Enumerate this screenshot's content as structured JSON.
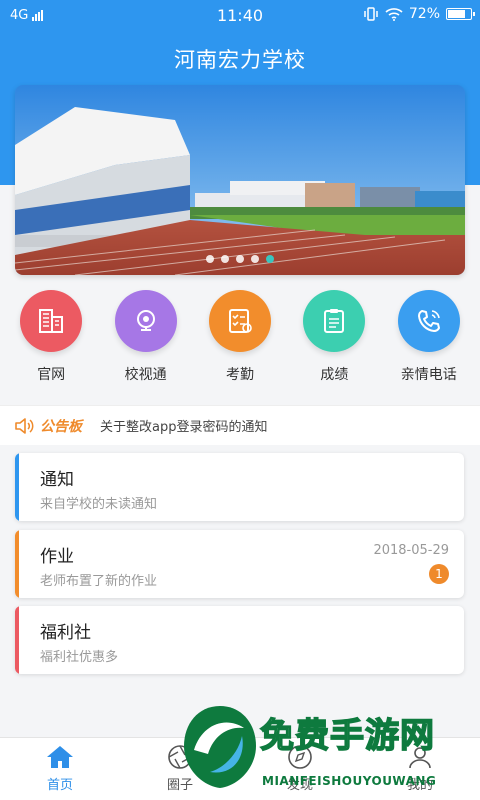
{
  "status_bar": {
    "network": "4G",
    "time": "11:40",
    "battery": "72%",
    "battery_level": 0.72
  },
  "header": {
    "title": "河南宏力学校"
  },
  "banner": {
    "slide_count": 5,
    "active_slide": 5
  },
  "quick_actions": [
    {
      "label": "官网",
      "icon": "building-icon",
      "color": "#ec5a62"
    },
    {
      "label": "校视通",
      "icon": "camera-icon",
      "color": "#a677e6"
    },
    {
      "label": "考勤",
      "icon": "checklist-icon",
      "color": "#f28d2c"
    },
    {
      "label": "成绩",
      "icon": "clipboard-icon",
      "color": "#3ccfb0"
    },
    {
      "label": "亲情电话",
      "icon": "phone-icon",
      "color": "#3a9ef0"
    }
  ],
  "notice": {
    "tag": "公告板",
    "message": "关于整改app登录密码的通知"
  },
  "cards": [
    {
      "title": "通知",
      "subtitle": "来自学校的未读通知",
      "color": "#2e96ef",
      "date": "",
      "badge": ""
    },
    {
      "title": "作业",
      "subtitle": "老师布置了新的作业",
      "color": "#f28d2c",
      "date": "2018-05-29",
      "badge": "1"
    },
    {
      "title": "福利社",
      "subtitle": "福利社优惠多",
      "color": "#ec5a62",
      "date": "",
      "badge": ""
    }
  ],
  "tabbar": {
    "home": "首页",
    "circle": "圈子",
    "discover": "发现",
    "mine": "我的"
  },
  "watermark": {
    "cn": "免费手游网",
    "en": "MIANFEISHOUYOUWANG"
  }
}
